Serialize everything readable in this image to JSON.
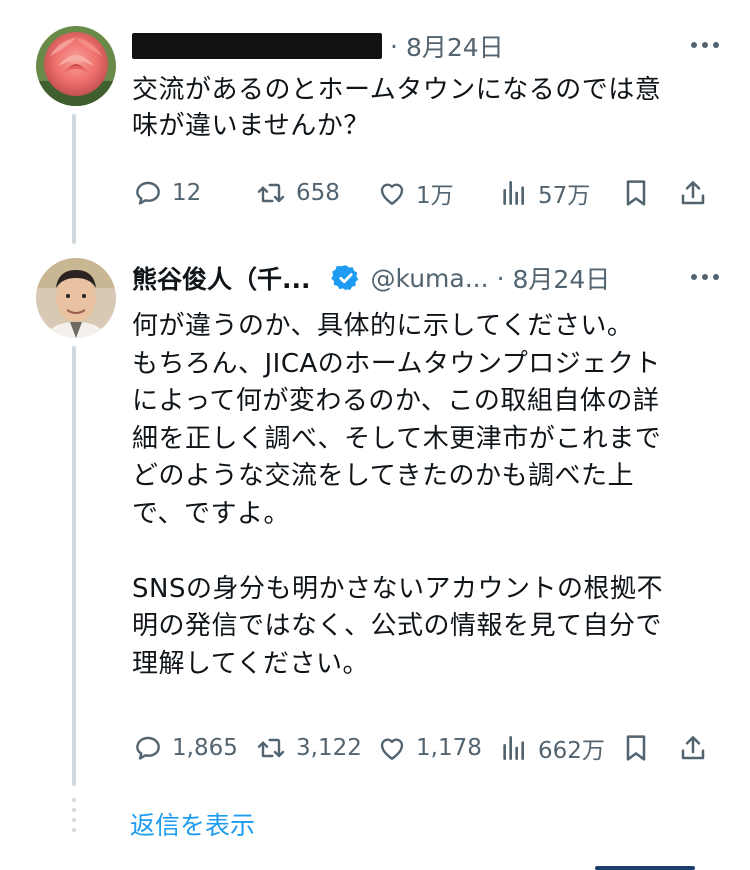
{
  "tweet1": {
    "author_name": "",
    "separator": "·",
    "date": "8月24日",
    "text": "交流があるのとホームタウンになるのでは意\n味が違いませんか？",
    "actions": {
      "replies": "12",
      "reposts": "658",
      "likes": "1万",
      "views": "57万"
    }
  },
  "tweet2": {
    "author_name": "熊谷俊人（千...",
    "handle": "@kuma...",
    "separator": "·",
    "date": "8月24日",
    "text": "何が違うのか、具体的に示してください。\nもちろん、JICAのホームタウンプロジェクト\nによって何が変わるのか、この取組自体の詳\n細を正しく調べ、そして木更津市がこれまで\nどのような交流をしてきたのかも調べた上\nで、ですよ。\n\nSNSの身分も明かさないアカウントの根拠不\n明の発信ではなく、公式の情報を見て自分で\n理解してください。",
    "actions": {
      "replies": "1,865",
      "reposts": "3,122",
      "likes": "1,178",
      "views": "662万"
    }
  },
  "show_replies_label": "返信を表示",
  "colors": {
    "text": "#0f1419",
    "secondary": "#536471",
    "accent": "#1d9bf0",
    "thread_line": "#cfd9de"
  },
  "icons": {
    "reply": "reply-icon",
    "repost": "repost-icon",
    "like": "heart-icon",
    "views": "views-icon",
    "bookmark": "bookmark-icon",
    "share": "share-icon",
    "more": "more-icon",
    "verified": "verified-badge-icon"
  }
}
